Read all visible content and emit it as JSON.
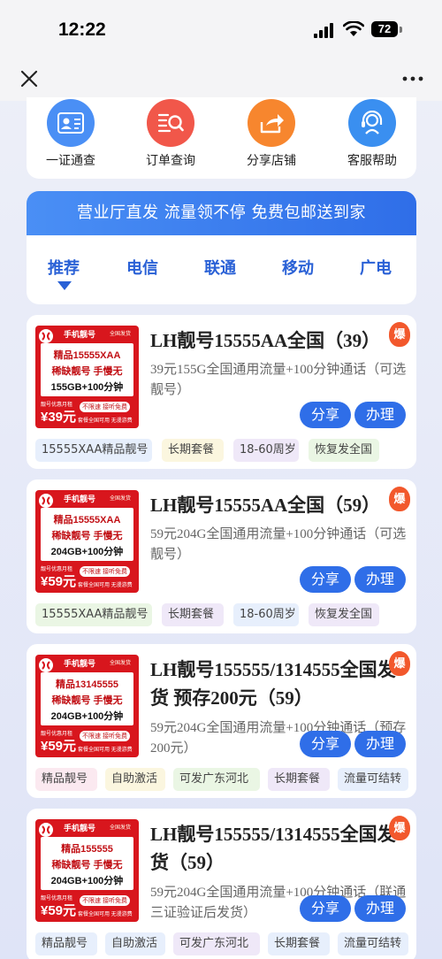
{
  "status": {
    "time": "12:22",
    "battery": "72"
  },
  "quick_actions": [
    {
      "label": "一证通查",
      "icon": "id-card-icon",
      "color": "#4a8ff5"
    },
    {
      "label": "订单查询",
      "icon": "order-search-icon",
      "color": "#f1574a"
    },
    {
      "label": "分享店铺",
      "icon": "share-icon",
      "color": "#f7862e"
    },
    {
      "label": "客服帮助",
      "icon": "headset-icon",
      "color": "#3a8ff0"
    }
  ],
  "promo": {
    "banner": "营业厅直发 流量领不停 免费包邮送到家",
    "tabs": [
      "推荐",
      "电信",
      "联通",
      "移动",
      "广电"
    ]
  },
  "products": [
    {
      "title": "LH靓号15555AA全国（39）",
      "desc": "39元155G全国通用流量+100分钟通话（可选靓号）",
      "poster": {
        "tag": "手机靓号",
        "tag2": "全国发货",
        "line1": "精品15555XAA",
        "line2": "稀缺靓号 手慢无",
        "line3": "155GB+100分钟",
        "price_label": "靓号优惠月租",
        "price": "¥39元",
        "note1": "不限速 接听免费",
        "note2": "套餐全国可用 无漫游费"
      },
      "share": "分享",
      "apply": "办理",
      "badge": "爆",
      "tags": [
        "15555XAA精品靓号",
        "长期套餐",
        "18-60周岁",
        "恢复发全国"
      ]
    },
    {
      "title": "LH靓号15555AA全国（59）",
      "desc": "59元204G全国通用流量+100分钟通话（可选靓号）",
      "poster": {
        "tag": "手机靓号",
        "tag2": "全国发货",
        "line1": "精品15555XAA",
        "line2": "稀缺靓号 手慢无",
        "line3": "204GB+100分钟",
        "price_label": "靓号优惠月租",
        "price": "¥59元",
        "note1": "不限速 接听免费",
        "note2": "套餐全国可用 无漫游费"
      },
      "share": "分享",
      "apply": "办理",
      "badge": "爆",
      "tags": [
        "15555XAA精品靓号",
        "长期套餐",
        "18-60周岁",
        "恢复发全国"
      ]
    },
    {
      "title": "LH靓号155555/1314555全国发货 预存200元（59）",
      "desc": "59元204G全国通用流量+100分钟通话（预存200元）",
      "poster": {
        "tag": "手机靓号",
        "tag2": "全国发货",
        "line1": "精品13145555",
        "line2": "稀缺靓号 手慢无",
        "line3": "204GB+100分钟",
        "price_label": "靓号优惠月租",
        "price": "¥59元",
        "note1": "不限速 接听免费",
        "note2": "套餐全国可用 无漫游费"
      },
      "share": "分享",
      "apply": "办理",
      "badge": "爆",
      "tags": [
        "精品靓号",
        "自助激活",
        "可发广东河北",
        "长期套餐",
        "流量可结转"
      ]
    },
    {
      "title": "LH靓号155555/1314555全国发货（59）",
      "desc": "59元204G全国通用流量+100分钟通话（联通三证验证后发货）",
      "poster": {
        "tag": "手机靓号",
        "tag2": "全国发货",
        "line1": "精品155555",
        "line2": "稀缺靓号 手慢无",
        "line3": "204GB+100分钟",
        "price_label": "靓号优惠月租",
        "price": "¥59元",
        "note1": "不限速 接听免费",
        "note2": "套餐全国可用 无漫游费"
      },
      "share": "分享",
      "apply": "办理",
      "badge": "爆",
      "tags": [
        "精品靓号",
        "自助激活",
        "可发广东河北",
        "长期套餐",
        "流量可结转"
      ]
    }
  ]
}
